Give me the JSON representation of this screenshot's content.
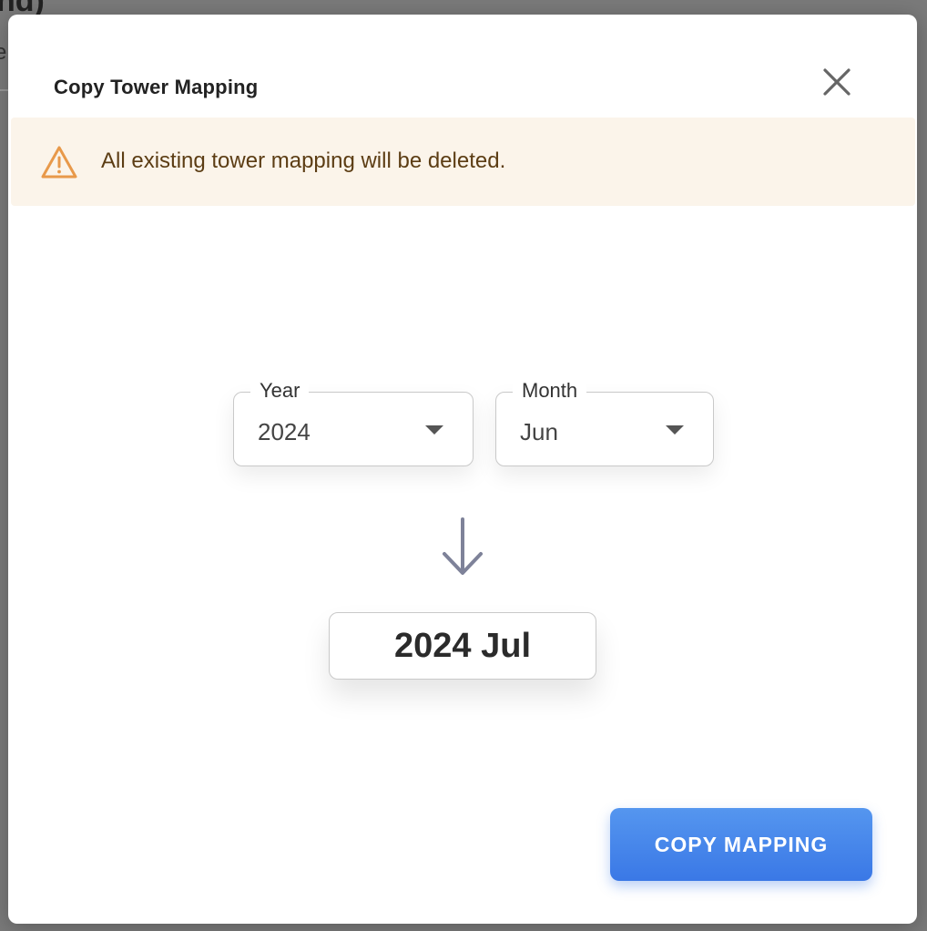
{
  "background": {
    "fragment_top": "nd)",
    "fragment_side": "e"
  },
  "modal": {
    "title": "Copy Tower Mapping",
    "close_icon": "close-icon"
  },
  "alert": {
    "icon": "warning-triangle-icon",
    "icon_color": "#e8994a",
    "text": "All existing tower mapping will be deleted."
  },
  "source": {
    "year": {
      "label": "Year",
      "value": "2024"
    },
    "month": {
      "label": "Month",
      "value": "Jun"
    }
  },
  "arrow_icon": "arrow-down-icon",
  "target": {
    "value": "2024 Jul"
  },
  "actions": {
    "copy_label": "COPY MAPPING",
    "accent_color": "#3a78e6"
  }
}
